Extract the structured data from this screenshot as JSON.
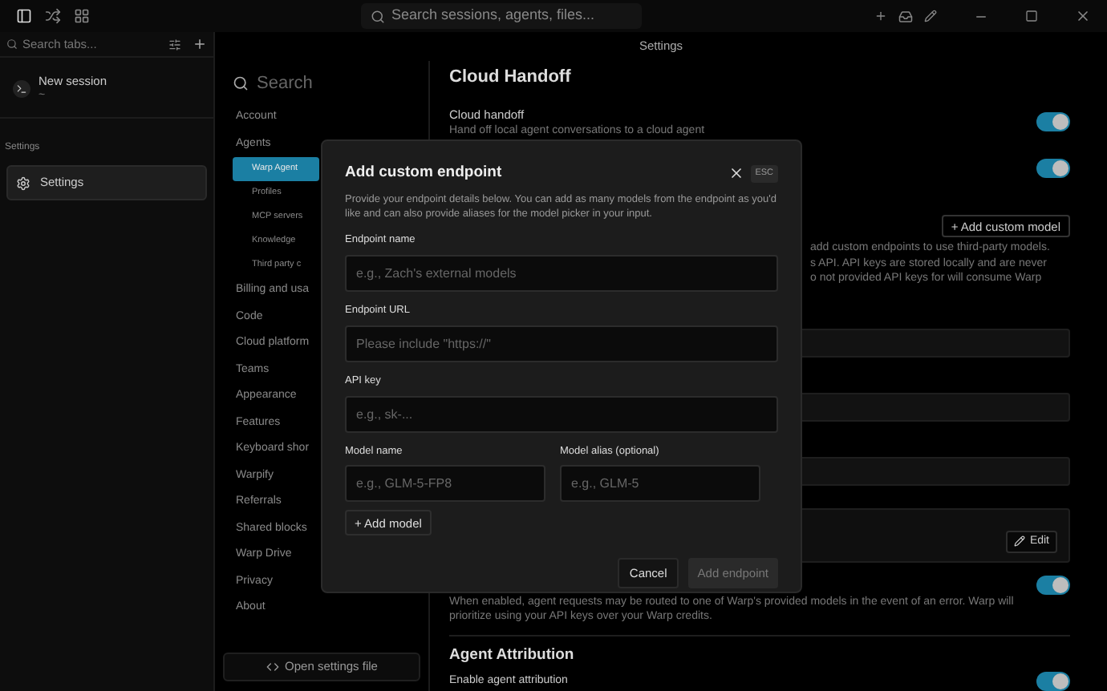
{
  "title_bar": {
    "search_placeholder": "Search sessions, agents, files..."
  },
  "tabs_panel": {
    "search_placeholder": "Search tabs...",
    "sessions": [
      {
        "title": "New session",
        "subtitle": "~",
        "selected": false
      }
    ],
    "section_label": "Settings",
    "items": [
      {
        "title": "Settings",
        "selected": true
      }
    ]
  },
  "header": {
    "title": "Settings"
  },
  "settings_nav": {
    "search_placeholder": "Search",
    "items": [
      {
        "label": "Account",
        "selected": false
      },
      {
        "label": "Agents",
        "selected": false,
        "children": [
          {
            "label": "Warp Agent",
            "selected": true
          },
          {
            "label": "Profiles",
            "selected": false
          },
          {
            "label": "MCP servers",
            "selected": false
          },
          {
            "label": "Knowledge",
            "selected": false
          },
          {
            "label": "Third party c",
            "selected": false
          }
        ]
      },
      {
        "label": "Billing and usa",
        "selected": false
      },
      {
        "label": "Code",
        "selected": false
      },
      {
        "label": "Cloud platform",
        "selected": false
      },
      {
        "label": "Teams",
        "selected": false
      },
      {
        "label": "Appearance",
        "selected": false
      },
      {
        "label": "Features",
        "selected": false
      },
      {
        "label": "Keyboard shor",
        "selected": false
      },
      {
        "label": "Warpify",
        "selected": false
      },
      {
        "label": "Referrals",
        "selected": false
      },
      {
        "label": "Shared blocks",
        "selected": false
      },
      {
        "label": "Warp Drive",
        "selected": false
      },
      {
        "label": "Privacy",
        "selected": false
      },
      {
        "label": "About",
        "selected": false
      }
    ],
    "open_file_button": "Open settings file"
  },
  "content": {
    "cloud_handoff": {
      "title": "Cloud Handoff",
      "setting_label": "Cloud handoff",
      "description": "Hand off local agent conversations to a cloud agent",
      "toggles": [
        {
          "on": true
        },
        {
          "on": true
        }
      ]
    },
    "custom_models": {
      "add_button": "+ Add custom model",
      "description_lines": [
        "add custom endpoints to use third-party models.",
        "s API. API keys are stored locally and are never",
        "o not provided API keys for will consume Warp"
      ],
      "edit_button": "Edit"
    },
    "fallback": {
      "description": "When enabled, agent requests may be routed to one of Warp's provided models in the event of an error. Warp will prioritize using your API keys over your Warp credits.",
      "on": true
    },
    "attribution": {
      "title": "Agent Attribution",
      "setting_label": "Enable agent attribution",
      "on": true
    }
  },
  "dialog": {
    "title": "Add custom endpoint",
    "esc_hint": "ESC",
    "description": "Provide your endpoint details below. You can add as many models from the endpoint as you'd like and can also provide aliases for the model picker in your input.",
    "fields": [
      {
        "label": "Endpoint name",
        "placeholder": "e.g., Zach's external models"
      },
      {
        "label": "Endpoint URL",
        "placeholder": "Please include \"https://\""
      },
      {
        "label": "API key",
        "placeholder": "e.g., sk-..."
      }
    ],
    "model_fields": [
      {
        "label": "Model name",
        "placeholder": "e.g., GLM-5-FP8"
      },
      {
        "label": "Model alias (optional)",
        "placeholder": "e.g., GLM-5"
      }
    ],
    "add_model_button": "+ Add model",
    "buttons": [
      {
        "label": "Cancel",
        "disabled": false
      },
      {
        "label": "Add endpoint",
        "disabled": true
      }
    ]
  }
}
